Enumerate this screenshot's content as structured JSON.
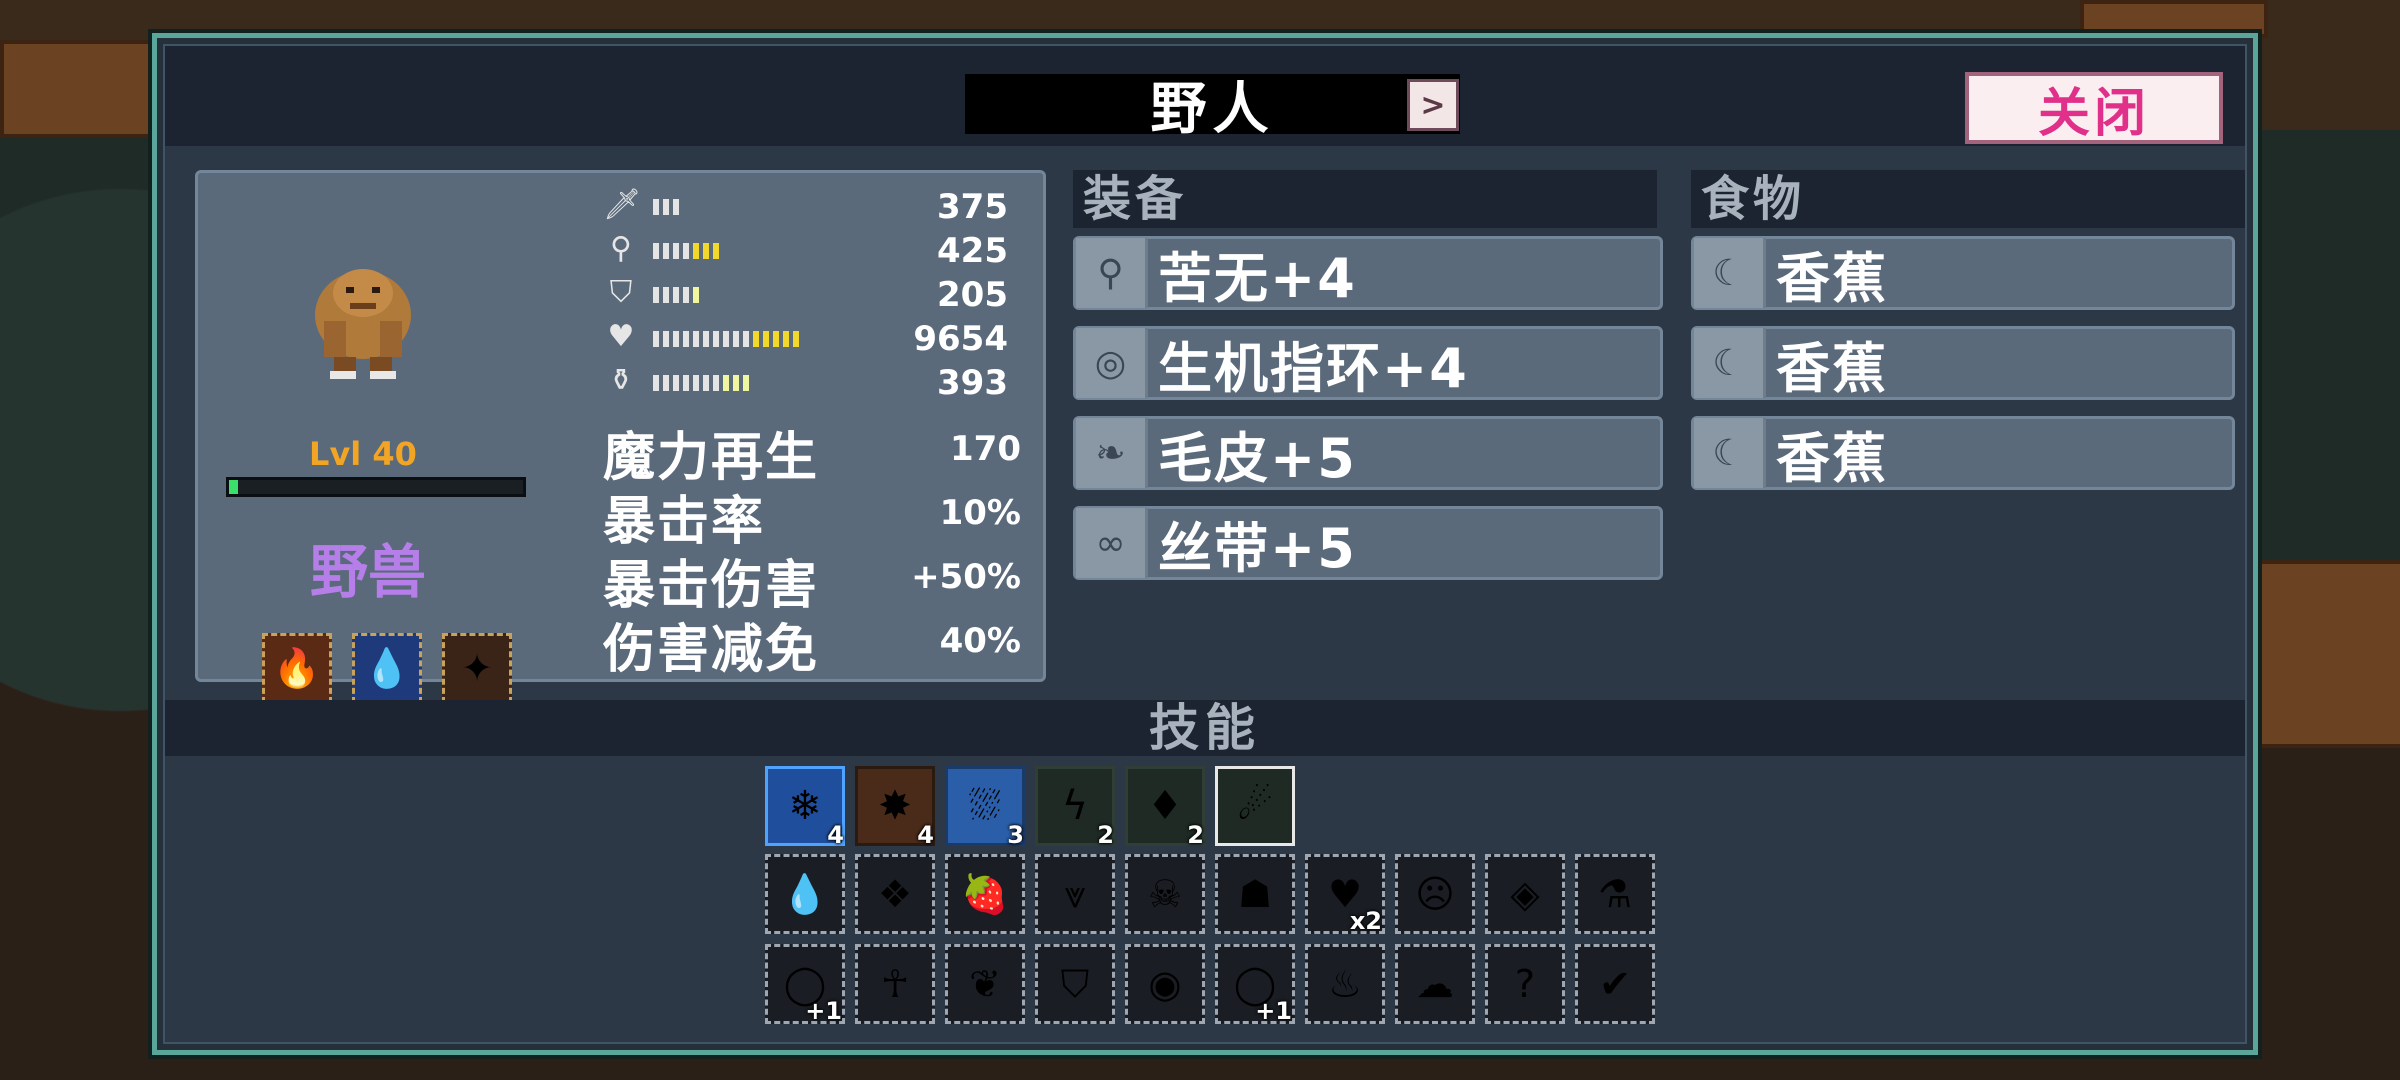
{
  "header": {
    "character_name": "野人",
    "prev_label": "<",
    "next_label": ">",
    "close_label": "关闭"
  },
  "character": {
    "level_text": "Lvl 40",
    "xp_fraction": 0.03,
    "class_name": "野兽",
    "traits": [
      {
        "icon": "fire-arrow-icon",
        "glyph": "🔥",
        "color": "#5a2a14"
      },
      {
        "icon": "fire-ice-icon",
        "glyph": "💧",
        "color": "#1e3a7a"
      },
      {
        "icon": "gold-sparkle-icon",
        "glyph": "✦",
        "color": "#3a2418"
      }
    ],
    "stats": [
      {
        "icon": "sword-icon",
        "glyph": "🗡",
        "value": "375",
        "bars_white": 3,
        "bars_yellow": 0,
        "bars_light": 0
      },
      {
        "icon": "staff-icon",
        "glyph": "⚲",
        "value": "425",
        "bars_white": 4,
        "bars_yellow": 3,
        "bars_light": 0
      },
      {
        "icon": "shield-icon",
        "glyph": "⛉",
        "value": "205",
        "bars_white": 4,
        "bars_yellow": 0,
        "bars_light": 1
      },
      {
        "icon": "heart-icon",
        "glyph": "♥",
        "value": "9654",
        "bars_white": 10,
        "bars_yellow": 5,
        "bars_light": 0
      },
      {
        "icon": "potion-icon",
        "glyph": "⚱",
        "value": "393",
        "bars_white": 7,
        "bars_yellow": 0,
        "bars_light": 3
      }
    ],
    "secondary": [
      {
        "label": "魔力再生",
        "value": "170"
      },
      {
        "label": "暴击率",
        "value": "10%"
      },
      {
        "label": "暴击伤害",
        "value": "+50%"
      },
      {
        "label": "伤害减免",
        "value": "40%"
      }
    ]
  },
  "equipment": {
    "header": "装备",
    "items": [
      {
        "icon": "kunai-icon",
        "glyph": "⚲",
        "label": "苦无+4"
      },
      {
        "icon": "ring-icon",
        "glyph": "◎",
        "label": "生机指环+4"
      },
      {
        "icon": "fur-icon",
        "glyph": "❧",
        "label": "毛皮+5"
      },
      {
        "icon": "ribbon-icon",
        "glyph": "∞",
        "label": "丝带+5"
      }
    ]
  },
  "food": {
    "header": "食物",
    "items": [
      {
        "icon": "banana-icon",
        "glyph": "☾",
        "label": "香蕉"
      },
      {
        "icon": "banana-icon",
        "glyph": "☾",
        "label": "香蕉"
      },
      {
        "icon": "banana-icon",
        "glyph": "☾",
        "label": "香蕉"
      }
    ]
  },
  "skills": {
    "header": "技能",
    "active": [
      {
        "icon": "ice-orb-icon",
        "glyph": "❄",
        "count": "4",
        "bg": "#1f4f9c",
        "border": "#4fa3ff"
      },
      {
        "icon": "burst-icon",
        "glyph": "✸",
        "count": "4",
        "bg": "#4a2a18",
        "border": "#2a1a10"
      },
      {
        "icon": "frost-pillar-icon",
        "glyph": "⛆",
        "count": "3",
        "bg": "#2a5ea8",
        "border": "#1a3a6a"
      },
      {
        "icon": "lightning-icon",
        "glyph": "ϟ",
        "count": "2",
        "bg": "#1f2a24",
        "border": "#2f3f36"
      },
      {
        "icon": "poison-crystal-icon",
        "glyph": "♦",
        "count": "2",
        "bg": "#1f2a24",
        "border": "#2f3f36"
      },
      {
        "icon": "fireball-icon",
        "glyph": "☄",
        "count": "",
        "bg": "#1f2a24",
        "border": "#e8e8e8"
      }
    ],
    "passives_row1": [
      {
        "icon": "water-drop-icon",
        "glyph": "💧",
        "count": ""
      },
      {
        "icon": "ice-shards-icon",
        "glyph": "❖",
        "count": ""
      },
      {
        "icon": "strawberry-icon",
        "glyph": "🍓",
        "count": ""
      },
      {
        "icon": "icicles-icon",
        "glyph": "⩔",
        "count": ""
      },
      {
        "icon": "skull-icon",
        "glyph": "☠",
        "count": ""
      },
      {
        "icon": "demon-mask-icon",
        "glyph": "☗",
        "count": ""
      },
      {
        "icon": "green-heart-icon",
        "glyph": "♥",
        "count": "x2"
      },
      {
        "icon": "angry-face-icon",
        "glyph": "☹",
        "count": ""
      },
      {
        "icon": "heart-diamond-icon",
        "glyph": "◈",
        "count": ""
      },
      {
        "icon": "gold-flask-icon",
        "glyph": "⚗",
        "count": ""
      }
    ],
    "passives_row2": [
      {
        "icon": "gold-ring-icon",
        "glyph": "◯",
        "count": "+1"
      },
      {
        "icon": "green-ankh-icon",
        "glyph": "☥",
        "count": ""
      },
      {
        "icon": "red-hearts-icon",
        "glyph": "❦",
        "count": ""
      },
      {
        "icon": "purple-shield-icon",
        "glyph": "⛉",
        "count": ""
      },
      {
        "icon": "green-vortex-icon",
        "glyph": "◉",
        "count": ""
      },
      {
        "icon": "green-ring-icon",
        "glyph": "◯",
        "count": "+1"
      },
      {
        "icon": "fire-heart-icon",
        "glyph": "♨",
        "count": ""
      },
      {
        "icon": "ghost-cloud-icon",
        "glyph": "☁",
        "count": ""
      },
      {
        "icon": "mystery-box-icon",
        "glyph": "?",
        "count": ""
      },
      {
        "icon": "arrow-check-icon",
        "glyph": "✔",
        "count": ""
      }
    ]
  }
}
